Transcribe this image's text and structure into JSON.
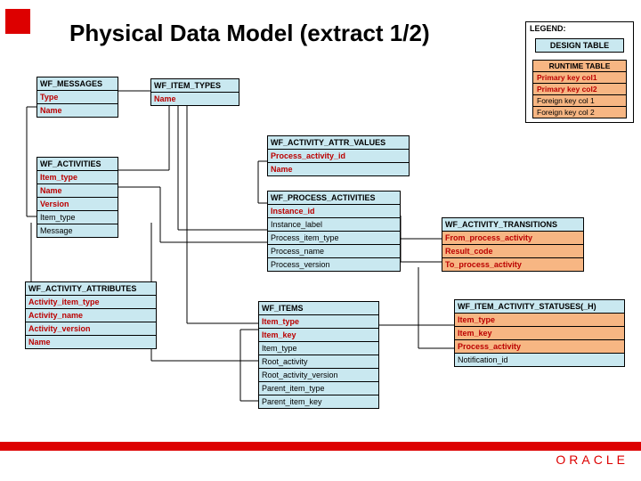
{
  "title": "Physical Data Model (extract 1/2)",
  "logo": "ORACLE",
  "legend": {
    "header": "LEGEND:",
    "design_label": "DESIGN TABLE",
    "runtime_label": "RUNTIME TABLE",
    "pk1": "Primary key col1",
    "pk2": "Primary key col2",
    "fk1": "Foreign key col 1",
    "fk2": "Foreign key col 2"
  },
  "tables": {
    "wf_messages": {
      "name": "WF_MESSAGES",
      "rows": [
        {
          "label": "Type",
          "kind": "pk"
        },
        {
          "label": "Name",
          "kind": "pk"
        }
      ]
    },
    "wf_item_types": {
      "name": "WF_ITEM_TYPES",
      "rows": [
        {
          "label": "Name",
          "kind": "pk"
        }
      ]
    },
    "wf_activities": {
      "name": "WF_ACTIVITIES",
      "rows": [
        {
          "label": "Item_type",
          "kind": "pk"
        },
        {
          "label": "Name",
          "kind": "pk"
        },
        {
          "label": "Version",
          "kind": "pk"
        },
        {
          "label": "Item_type",
          "kind": "fk"
        },
        {
          "label": "Message",
          "kind": "fk"
        }
      ]
    },
    "wf_activity_attributes": {
      "name": "WF_ACTIVITY_ATTRIBUTES",
      "rows": [
        {
          "label": "Activity_item_type",
          "kind": "pk"
        },
        {
          "label": "Activity_name",
          "kind": "pk"
        },
        {
          "label": "Activity_version",
          "kind": "pk"
        },
        {
          "label": "Name",
          "kind": "pk"
        }
      ]
    },
    "wf_activity_attr_values": {
      "name": "WF_ACTIVITY_ATTR_VALUES",
      "rows": [
        {
          "label": "Process_activity_id",
          "kind": "pk"
        },
        {
          "label": "Name",
          "kind": "pk"
        }
      ]
    },
    "wf_process_activities": {
      "name": "WF_PROCESS_ACTIVITIES",
      "rows": [
        {
          "label": "Instance_id",
          "kind": "pk"
        },
        {
          "label": "Instance_label",
          "kind": "fk"
        },
        {
          "label": "Process_item_type",
          "kind": "fk"
        },
        {
          "label": "Process_name",
          "kind": "fk"
        },
        {
          "label": "Process_version",
          "kind": "fk"
        }
      ]
    },
    "wf_items": {
      "name": "WF_ITEMS",
      "rows": [
        {
          "label": "Item_type",
          "kind": "pk"
        },
        {
          "label": "Item_key",
          "kind": "pk"
        },
        {
          "label": "Item_type",
          "kind": "fk"
        },
        {
          "label": "Root_activity",
          "kind": "fk"
        },
        {
          "label": "Root_activity_version",
          "kind": "fk"
        },
        {
          "label": "Parent_item_type",
          "kind": "fk"
        },
        {
          "label": "Parent_item_key",
          "kind": "fk"
        }
      ]
    },
    "wf_activity_transitions": {
      "name": "WF_ACTIVITY_TRANSITIONS",
      "rows": [
        {
          "label": "From_process_activity",
          "kind": "pk"
        },
        {
          "label": "Result_code",
          "kind": "pk"
        },
        {
          "label": "To_process_activity",
          "kind": "pk"
        }
      ]
    },
    "wf_item_activity_statuses": {
      "name": "WF_ITEM_ACTIVITY_STATUSES(_H)",
      "rows": [
        {
          "label": "Item_type",
          "kind": "pk"
        },
        {
          "label": "Item_key",
          "kind": "pk"
        },
        {
          "label": "Process_activity",
          "kind": "pk"
        },
        {
          "label": "Notification_id",
          "kind": "fk"
        }
      ]
    }
  }
}
